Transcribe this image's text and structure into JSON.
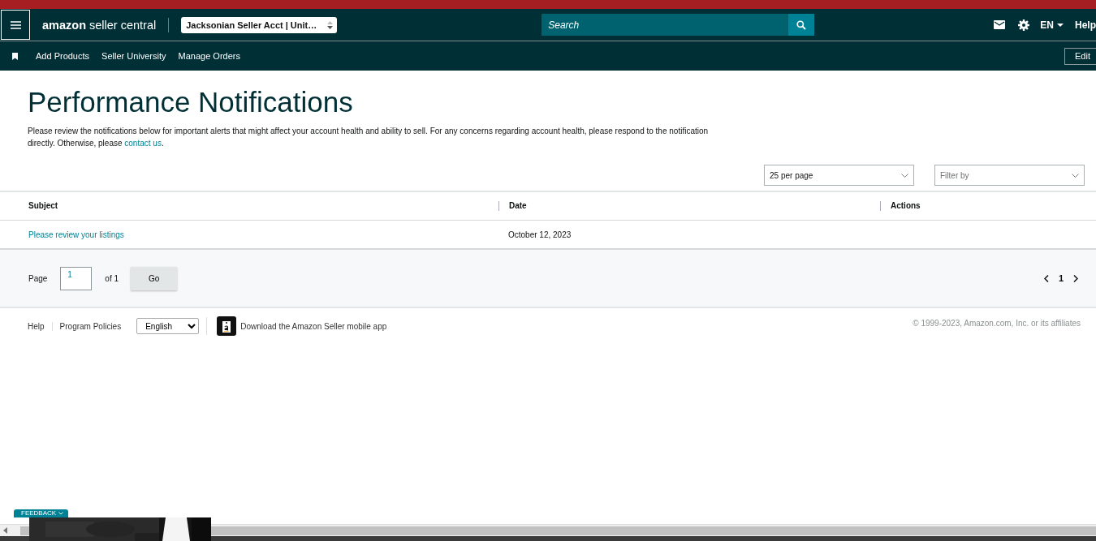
{
  "header": {
    "logo": "**amazon** seller central",
    "account": "Jacksonian Seller Acct | Unit…",
    "search": {
      "placeholder": "Search"
    },
    "language": "EN",
    "help": "Help"
  },
  "nav": {
    "links": [
      "Add Products",
      "Seller University",
      "Manage Orders"
    ],
    "edit": "Edit"
  },
  "page": {
    "title": "Performance Notifications",
    "intro": "Please review the notifications below for important alerts that might affect your account health and ability to sell. For any concerns regarding account health, please respond to the notification directly. Otherwise, please ",
    "intro_link": "contact us",
    "intro_end": "."
  },
  "controls": {
    "per_page": "25 per page",
    "filter": {
      "placeholder": "Filter by"
    }
  },
  "table": {
    "columns": [
      "Subject",
      "Date",
      "Actions"
    ],
    "rows": [
      {
        "subject": "Please review your listings",
        "date": "October 12, 2023"
      }
    ]
  },
  "pagination": {
    "label": "Page",
    "page": "1",
    "of": "of 1",
    "go": "Go",
    "current": "1"
  },
  "footer": {
    "links": [
      "Help",
      "Program Policies"
    ],
    "language": "English",
    "app_text": "Download the Amazon Seller mobile app",
    "copyright": "© 1999-2023, Amazon.com, Inc. or its affiliates"
  },
  "feedback": "FEEDBACK"
}
